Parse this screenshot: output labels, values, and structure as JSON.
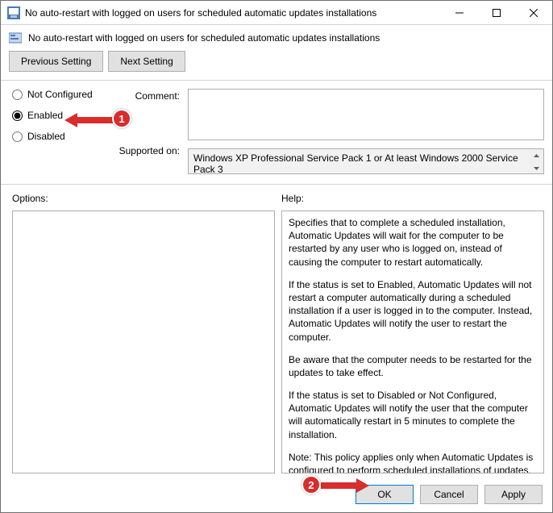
{
  "title": "No auto-restart with logged on users for scheduled automatic updates installations",
  "subheader": "No auto-restart with logged on users for scheduled automatic updates installations",
  "nav": {
    "prev": "Previous Setting",
    "next": "Next Setting"
  },
  "radios": {
    "not_configured": "Not Configured",
    "enabled": "Enabled",
    "disabled": "Disabled",
    "selected": "enabled"
  },
  "labels": {
    "comment": "Comment:",
    "supported": "Supported on:",
    "options": "Options:",
    "help": "Help:"
  },
  "comment": "",
  "supported_on": "Windows XP Professional Service Pack 1 or At least Windows 2000 Service Pack 3",
  "help": {
    "p1": "Specifies that to complete a scheduled installation, Automatic Updates will wait for the computer to be restarted by any user who is logged on, instead of causing the computer to restart automatically.",
    "p2": "If the status is set to Enabled, Automatic Updates will not restart a computer automatically during a scheduled installation if a user is logged in to the computer. Instead, Automatic Updates will notify the user to restart the computer.",
    "p3": "Be aware that the computer needs to be restarted for the updates to take effect.",
    "p4": "If the status is set to Disabled or Not Configured, Automatic Updates will notify the user that the computer will automatically restart in 5 minutes to complete the installation.",
    "p5": "Note: This policy applies only when Automatic Updates is configured to perform scheduled installations of updates. If the"
  },
  "buttons": {
    "ok": "OK",
    "cancel": "Cancel",
    "apply": "Apply"
  },
  "annotations": {
    "badge1": "1",
    "badge2": "2"
  }
}
